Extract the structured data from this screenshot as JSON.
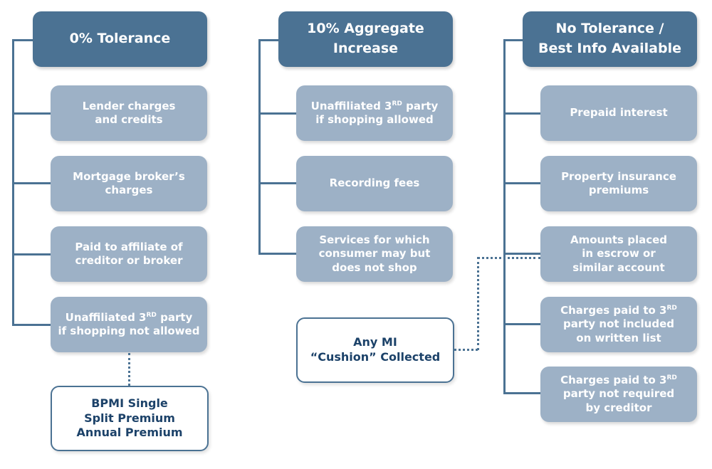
{
  "columns": [
    {
      "header": "0% Tolerance",
      "items": [
        {
          "pre": "Lender charges\nand credits",
          "sup": "",
          "post": ""
        },
        {
          "pre": "Mortgage broker’s\ncharges",
          "sup": "",
          "post": ""
        },
        {
          "pre": "Paid to affiliate of\ncreditor or broker",
          "sup": "",
          "post": ""
        },
        {
          "pre": "Unaffiliated 3",
          "sup": "RD",
          "post": " party\nif shopping not allowed"
        }
      ],
      "note": "BPMI Single\nSplit Premium\nAnnual Premium"
    },
    {
      "header": "10% Aggregate\nIncrease",
      "items": [
        {
          "pre": "Unaffiliated 3",
          "sup": "RD",
          "post": " party\nif shopping allowed"
        },
        {
          "pre": "Recording fees",
          "sup": "",
          "post": ""
        },
        {
          "pre": "Services for which\nconsumer may but\ndoes not shop",
          "sup": "",
          "post": ""
        }
      ],
      "note": "Any MI\n“Cushion” Collected"
    },
    {
      "header": "No Tolerance /\nBest Info Available",
      "items": [
        {
          "pre": "Prepaid interest",
          "sup": "",
          "post": ""
        },
        {
          "pre": "Property insurance\npremiums",
          "sup": "",
          "post": ""
        },
        {
          "pre": "Amounts placed\nin escrow or\nsimilar account",
          "sup": "",
          "post": ""
        },
        {
          "pre": "Charges paid to 3",
          "sup": "RD",
          "post": "\nparty not included\non written list"
        },
        {
          "pre": "Charges paid to 3",
          "sup": "RD",
          "post": "\nparty not required\nby creditor"
        }
      ]
    }
  ],
  "colors": {
    "header": "#4b7293",
    "item": "#9db1c6",
    "note_text": "#1c4269"
  }
}
